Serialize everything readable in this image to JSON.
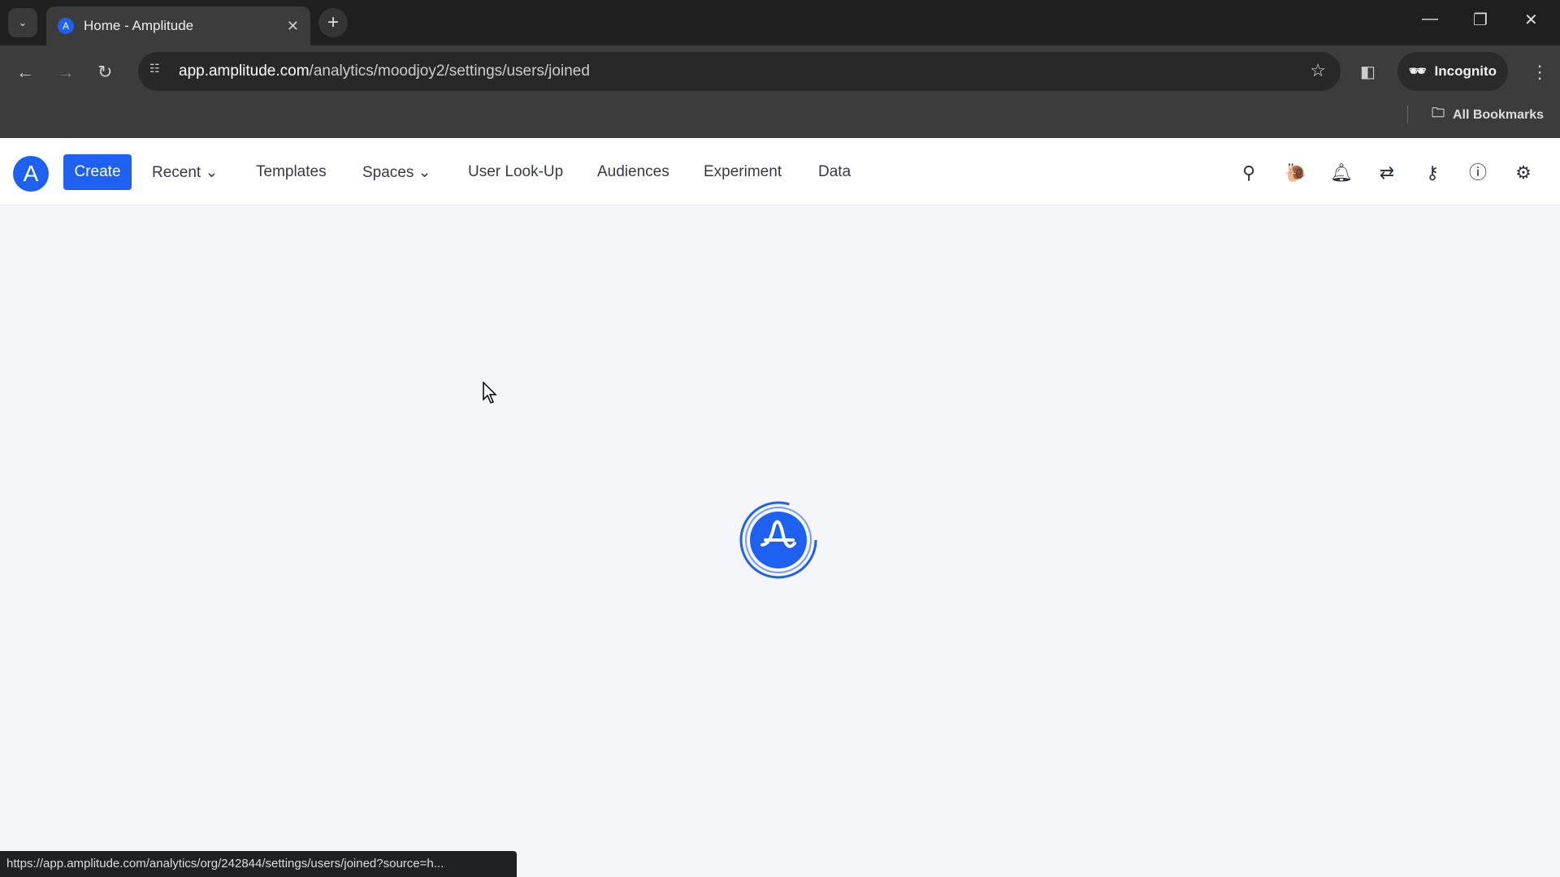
{
  "browser": {
    "tab_title": "Home - Amplitude",
    "url_host": "app.amplitude.com",
    "url_path": "/analytics/moodjoy2/settings/users/joined",
    "incognito_label": "Incognito",
    "bookmarks_label": "All Bookmarks",
    "status_url": "https://app.amplitude.com/analytics/org/242844/settings/users/joined?source=h..."
  },
  "nav": {
    "create": "Create",
    "items": [
      "Recent",
      "Templates",
      "Spaces",
      "User Look-Up",
      "Audiences",
      "Experiment",
      "Data"
    ]
  },
  "icons": [
    "search-icon",
    "snail-icon",
    "bell-icon",
    "switch-icon",
    "key-sparkle-icon",
    "help-icon",
    "gear-icon"
  ],
  "colors": {
    "brand": "#1e61f0"
  }
}
